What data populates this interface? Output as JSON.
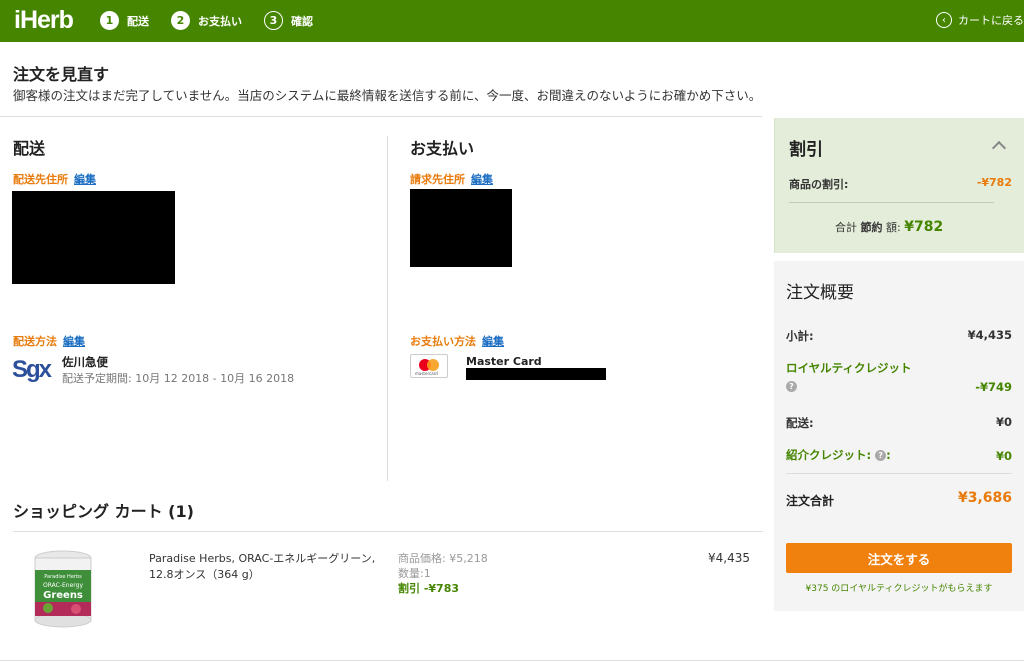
{
  "header": {
    "logo": "iHerb",
    "steps": [
      {
        "num": "1",
        "label": "配送"
      },
      {
        "num": "2",
        "label": "お支払い"
      },
      {
        "num": "3",
        "label": "確認"
      }
    ],
    "back_to_cart": "カートに戻る"
  },
  "review": {
    "title": "注文を見直す",
    "notice": "御客様の注文はまだ完了していません。当店のシステムに最終情報を送信する前に、今一度、お間違えのないようにお確かめ下さい。"
  },
  "shipping": {
    "title": "配送",
    "address_label": "配送先住所",
    "edit": "編集",
    "method_label": "配送方法",
    "carrier_logo": "Sgx",
    "carrier_name": "佐川急便",
    "delivery_estimate": "配送予定期間: 10月 12 2018 - 10月 16 2018"
  },
  "payment": {
    "title": "お支払い",
    "billing_label": "請求先住所",
    "edit": "編集",
    "method_label": "お支払い方法",
    "card_brand_text": "mastercard",
    "card_name": "Master Card"
  },
  "cart": {
    "title": "ショッピング カート (1)",
    "item": {
      "name": "Paradise Herbs, ORAC-エネルギーグリーン, 12.8オンス（364 g）",
      "unit_price": "商品価格: ¥5,218",
      "quantity": "数量:1",
      "discount": "割引 -¥783",
      "total": "¥4,435",
      "label_brand": "Paradise Herbs",
      "label_line1": "ORAC-Energy",
      "label_line2": "Greens"
    }
  },
  "discount_panel": {
    "title": "割引",
    "product_discount_label": "商品の割引:",
    "product_discount_value": "-¥782",
    "total_prefix": "合計",
    "total_bold": "節約",
    "total_suffix": "額:",
    "total_value": "¥782"
  },
  "summary": {
    "title": "注文概要",
    "subtotal_label": "小計:",
    "subtotal_value": "¥4,435",
    "loyalty_label": "ロイヤルティクレジット",
    "loyalty_value": "-¥749",
    "shipping_label": "配送:",
    "shipping_value": "¥0",
    "referral_label": "紹介クレジット:",
    "referral_suffix": ":",
    "referral_value": "¥0",
    "grand_total_label": "注文合計",
    "grand_total_value": "¥3,686",
    "order_button": "注文をする",
    "credit_note": "¥375 のロイヤルティクレジットがもらえます"
  },
  "colors": {
    "brand_green": "#458500",
    "accent_orange": "#f0810f",
    "link_blue": "#1a6dc2"
  }
}
